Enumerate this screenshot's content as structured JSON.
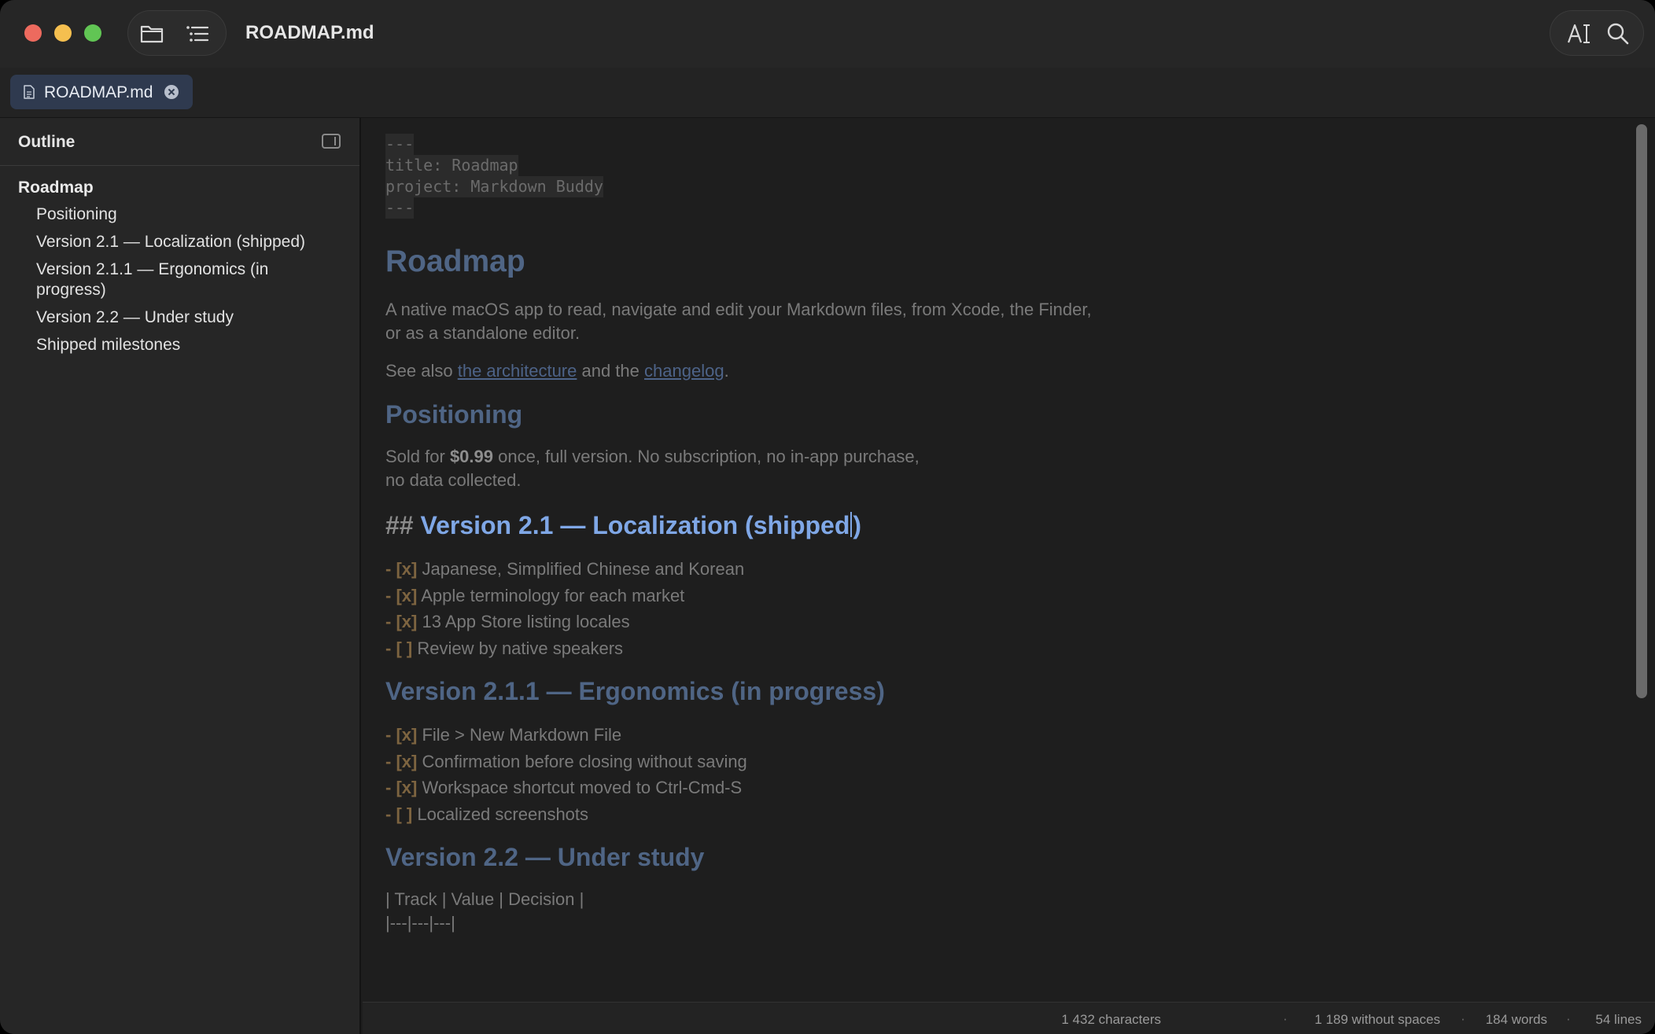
{
  "window": {
    "title": "ROADMAP.md"
  },
  "toolbar": {
    "folder_icon": "folder-icon",
    "outline_icon": "list-icon",
    "font_icon": "text-format-icon",
    "search_icon": "search-icon"
  },
  "tabs": [
    {
      "label": "ROADMAP.md",
      "active": true
    }
  ],
  "sidebar": {
    "title": "Outline",
    "items": [
      {
        "label": "Roadmap",
        "level": 1
      },
      {
        "label": "Positioning",
        "level": 2
      },
      {
        "label": "Version 2.1 — Localization (shipped)",
        "level": 2
      },
      {
        "label": "Version 2.1.1 — Ergonomics (in progress)",
        "level": 2
      },
      {
        "label": "Version 2.2 — Under study",
        "level": 2
      },
      {
        "label": "Shipped milestones",
        "level": 2
      }
    ]
  },
  "editor": {
    "frontmatter": [
      "---",
      "title: Roadmap",
      "project: Markdown Buddy",
      "---"
    ],
    "h1": "Roadmap",
    "intro": "A native macOS app to read, navigate and edit your Markdown files, from Xcode, the Finder, or as a standalone editor.",
    "see_also": {
      "prefix": "See also ",
      "link1": "the architecture",
      "middle": " and the ",
      "link2": "changelog",
      "suffix": "."
    },
    "positioning": {
      "heading": "Positioning",
      "prefix": "Sold for ",
      "price": "$0.99",
      "text1": " once, full version. No subscription, no in-app purchase,",
      "text2": "no data collected."
    },
    "v21": {
      "marker": "##",
      "heading_before_caret": "Version 2.1 — Localization (shipped",
      "heading_after_caret": ")",
      "tasks": [
        {
          "mark": "[x]",
          "text": "Japanese, Simplified Chinese and Korean"
        },
        {
          "mark": "[x]",
          "text": "Apple terminology for each market"
        },
        {
          "mark": "[x]",
          "text": "13 App Store listing locales"
        },
        {
          "mark": "[ ]",
          "text": "Review by native speakers"
        }
      ]
    },
    "v211": {
      "heading": "Version 2.1.1 — Ergonomics (in progress)",
      "tasks": [
        {
          "mark": "[x]",
          "text": "File > New Markdown File"
        },
        {
          "mark": "[x]",
          "text": "Confirmation before closing without saving"
        },
        {
          "mark": "[x]",
          "text": "Workspace shortcut moved to Ctrl-Cmd-S"
        },
        {
          "mark": "[ ]",
          "text": "Localized screenshots"
        }
      ]
    },
    "v22": {
      "heading": "Version 2.2 — Under study",
      "table_header": "| Track | Value | Decision |",
      "table_sep": "|---|---|---|"
    }
  },
  "statusbar": {
    "characters": "1 432 characters",
    "without_spaces": "1 189 without spaces",
    "words": "184 words",
    "lines": "54 lines",
    "separator": "·"
  },
  "colors": {
    "accent": "#7fa7e6",
    "heading": "#4f6585",
    "task_marker": "#7d6440"
  }
}
